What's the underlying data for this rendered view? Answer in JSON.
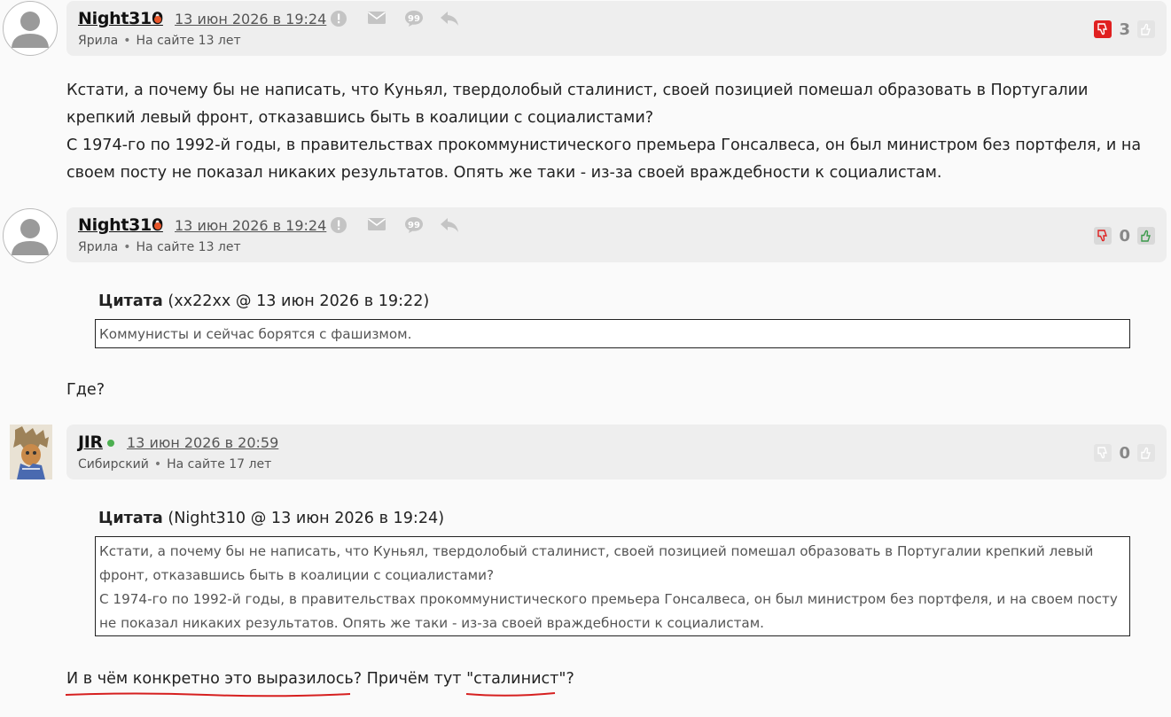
{
  "comments": [
    {
      "author": "Night310",
      "online_color": "#e8562a",
      "date": "13 июн 2026 в 19:24",
      "group": "Ярила",
      "site_age": "На сайте 13 лет",
      "score": "3",
      "avatar": "default-avatar-icon",
      "body": [
        "Кстати, а почему бы не написать, что Куньял, твердолобый сталинист, своей позицией помешал образовать в Португалии крепкий левый фронт, отказавшись быть в коалиции с социалистами?",
        "С 1974-го по 1992-й годы, в правительствах прокоммунистического премьера Гонсалвеса, он был министром без портфеля, и на своем посту не показал никаких результатов. Опять же таки - из-за своей враждебности к социалистам."
      ]
    },
    {
      "author": "Night310",
      "online_color": "#e8562a",
      "date": "13 июн 2026 в 19:24",
      "group": "Ярила",
      "site_age": "На сайте 13 лет",
      "score": "0",
      "avatar": "default-avatar-icon",
      "quote": {
        "label": "Цитата",
        "source": "(xx22xx @ 13 июн 2026 в 19:22)",
        "text": "Коммунисты и сейчас борятся с фашизмом."
      },
      "body": [
        "Где?"
      ]
    },
    {
      "author": "JIR",
      "online_color": "#4caf50",
      "date": "13 июн 2026 в 20:59",
      "group": "Сибирский",
      "site_age": "На сайте 17 лет",
      "score": "0",
      "avatar": "user-avatar-image",
      "quote": {
        "label": "Цитата",
        "source": "(Night310 @ 13 июн 2026 в 19:24)",
        "text_lines": [
          "Кстати, а почему бы не написать, что Куньял, твердолобый сталинист, своей позицией помешал образовать в Португалии крепкий левый фронт, отказавшись быть в коалиции с социалистами?",
          "С 1974-го по 1992-й годы, в правительствах прокоммунистического премьера Гонсалвеса, он был министром без портфеля, и на своем посту не показал никаких результатов. Опять же таки - из-за своей враждебности к социалистам."
        ]
      },
      "reply": {
        "part1": "И в чём конкретно это выразилось",
        "part2": "? Причём тут ",
        "part3": "\"сталинист\"",
        "part4": "?"
      }
    }
  ],
  "colors": {
    "header_bg": "#eeeeee",
    "dislike_active": "#e02020",
    "like_active": "#3a9a4a",
    "underline_red": "#d62020"
  }
}
